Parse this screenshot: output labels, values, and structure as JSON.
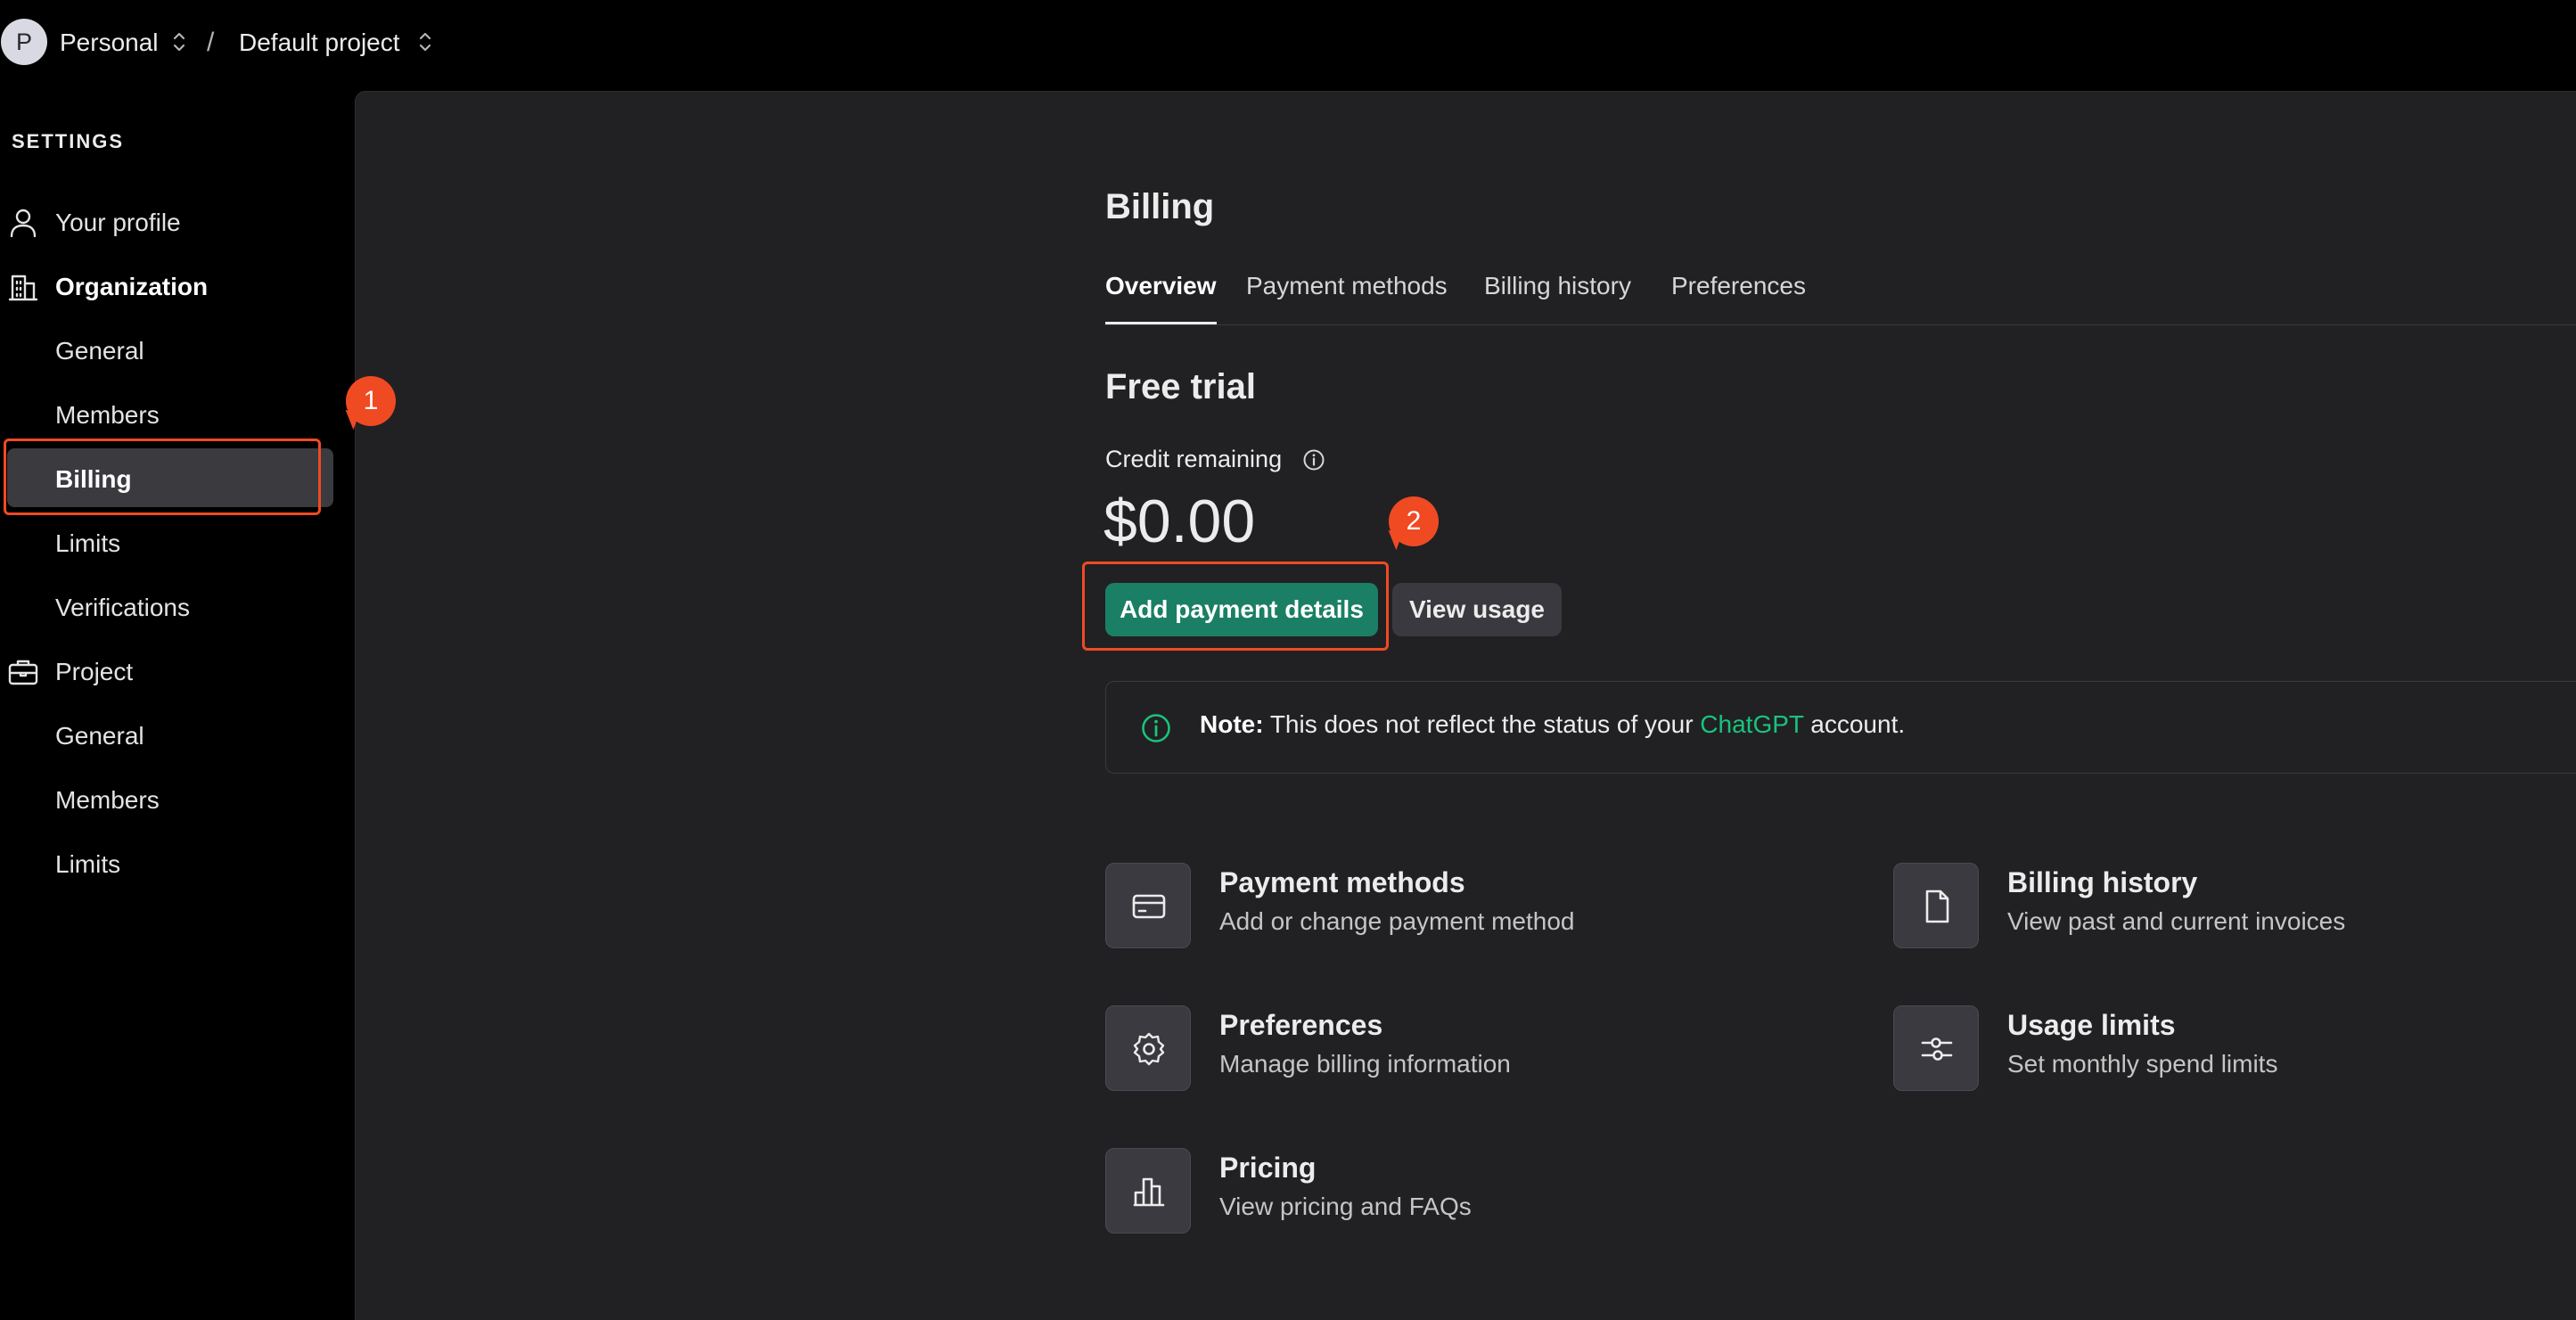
{
  "topbar": {
    "avatar_letter": "P",
    "org_name": "Personal",
    "separator": "/",
    "project_name": "Default project"
  },
  "sidebar": {
    "heading": "SETTINGS",
    "items": [
      {
        "label": "Your profile",
        "icon": "user-icon"
      },
      {
        "label": "Organization",
        "icon": "building-icon"
      },
      {
        "label": "General"
      },
      {
        "label": "Members"
      },
      {
        "label": "Billing",
        "active": true
      },
      {
        "label": "Limits"
      },
      {
        "label": "Verifications"
      },
      {
        "label": "Project",
        "icon": "briefcase-icon"
      },
      {
        "label": "General"
      },
      {
        "label": "Members"
      },
      {
        "label": "Limits"
      }
    ]
  },
  "main": {
    "title": "Billing",
    "tabs": [
      {
        "label": "Overview",
        "active": true
      },
      {
        "label": "Payment methods"
      },
      {
        "label": "Billing history"
      },
      {
        "label": "Preferences"
      }
    ],
    "plan_title": "Free trial",
    "credit_label": "Credit remaining",
    "credit_amount": "$0.00",
    "add_payment_label": "Add payment details",
    "view_usage_label": "View usage",
    "note": {
      "prefix": "Note:",
      "text_before": "This does not reflect the status of your",
      "link": "ChatGPT",
      "text_after": "account."
    },
    "cards": [
      {
        "title": "Payment methods",
        "desc": "Add or change payment method",
        "icon": "credit-card-icon"
      },
      {
        "title": "Billing history",
        "desc": "View past and current invoices",
        "icon": "document-icon"
      },
      {
        "title": "Preferences",
        "desc": "Manage billing information",
        "icon": "gear-icon"
      },
      {
        "title": "Usage limits",
        "desc": "Set monthly spend limits",
        "icon": "sliders-icon"
      },
      {
        "title": "Pricing",
        "desc": "View pricing and FAQs",
        "icon": "bar-chart-icon"
      }
    ]
  },
  "annotations": {
    "marker_1": "1",
    "marker_2": "2"
  },
  "colors": {
    "accent_green": "#1a7f64",
    "link_green": "#19c37d",
    "annotation_red": "#f04a23"
  }
}
